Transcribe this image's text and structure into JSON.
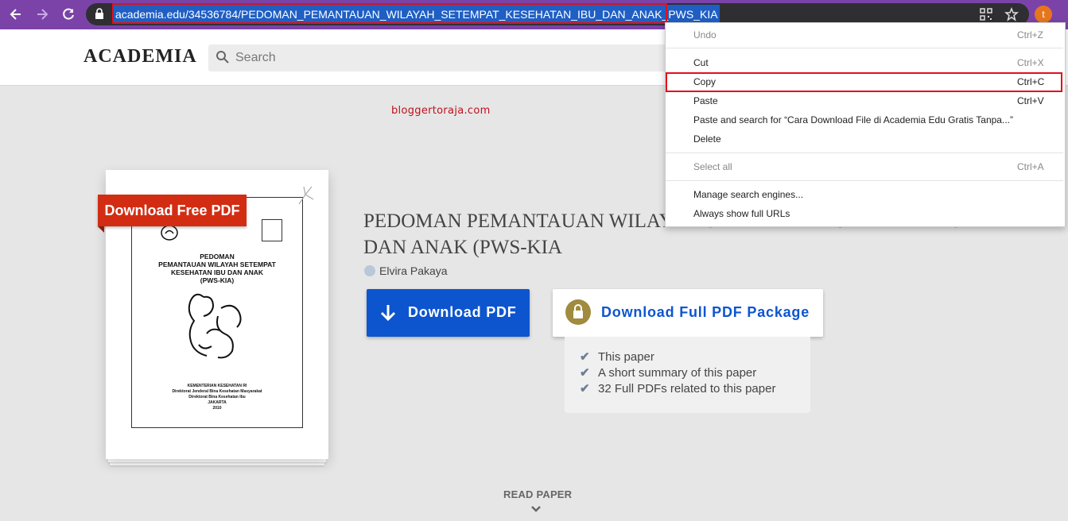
{
  "browser": {
    "url": "academia.edu/34536784/PEDOMAN_PEMANTAUAN_WILAYAH_SETEMPAT_KESEHATAN_IBU_DAN_ANAK_PWS_KIA",
    "profile_initial": "t",
    "nav_icons": [
      "back-arrow-icon",
      "forward-arrow-icon",
      "reload-icon",
      "lock-icon",
      "qr-code-icon",
      "bookmark-star-icon"
    ],
    "colors": {
      "toolbar": "#7b43a7",
      "url_selection": "#1f5fc4",
      "highlight_box": "#e0101c"
    }
  },
  "site": {
    "logo": "ACADEMIA",
    "search_placeholder": "Search"
  },
  "watermark": "bloggertoraja.com",
  "cover": {
    "badge": "Download Free PDF",
    "title_lines": [
      "PEDOMAN",
      "PEMANTAUAN WILAYAH SETEMPAT",
      "KESEHATAN IBU DAN ANAK",
      "(PWS-KIA)"
    ],
    "footer_lines": [
      "KEMENTERIAN KESEHATAN RI",
      "Direktorat Jenderal Bina Kesehatan Masyarakat",
      "Direktorat Bina Kesehatan Ibu",
      "JAKARTA",
      "2010"
    ]
  },
  "paper": {
    "title_line1": "PEDOMAN PEMANTAUAN WILAYAH SETEMPAT KESEHATAN IBU",
    "title_line2": "DAN ANAK (PWS-KIA",
    "author": "Elvira Pakaya",
    "download_label": "Download PDF",
    "package_label": "Download Full PDF Package",
    "benefits": [
      "This paper",
      "A short summary of this paper",
      "32 Full PDFs related to this paper"
    ],
    "read_paper": "READ PAPER",
    "colors": {
      "primary": "#0d55cf",
      "badge": "#d22d13",
      "lock": "#a08b3e"
    }
  },
  "context_menu": {
    "items": [
      {
        "label": "Undo",
        "shortcut": "Ctrl+Z",
        "disabled": true
      },
      {
        "label": "Cut",
        "shortcut": "Ctrl+X",
        "disabled": false
      },
      {
        "label": "Copy",
        "shortcut": "Ctrl+C",
        "disabled": false,
        "highlighted": true
      },
      {
        "label": "Paste",
        "shortcut": "Ctrl+V",
        "disabled": false
      },
      {
        "label": "Paste and search for “Cara Download File di Academia Edu Gratis Tanpa...”",
        "shortcut": "",
        "disabled": false
      },
      {
        "label": "Delete",
        "shortcut": "",
        "disabled": false
      },
      {
        "label": "Select all",
        "shortcut": "Ctrl+A",
        "disabled": true
      },
      {
        "label": "Manage search engines...",
        "shortcut": "",
        "disabled": false
      },
      {
        "label": "Always show full URLs",
        "shortcut": "",
        "disabled": false
      }
    ]
  }
}
